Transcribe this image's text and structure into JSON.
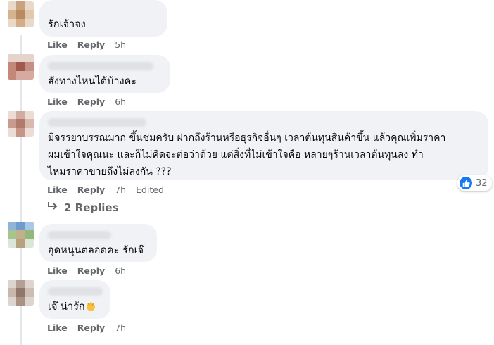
{
  "comments": [
    {
      "text": "รักเจ้าจง",
      "like": "Like",
      "reply": "Reply",
      "time": "5h"
    },
    {
      "text": "สังทางไหนได้บ้างคะ",
      "like": "Like",
      "reply": "Reply",
      "time": "6h"
    },
    {
      "text": "มีจรรยาบรรณมาก ขึ้นชมครับ ฝากถึงร้านหรือธุรกิจอื่นๆ เวลาต้นทุนสินค้าขึ้น แล้วคุณเพิ่มราคา\nผมเข้าใจคุณนะ และก็ไม่คิดจะต่อว่าด้วย แต่สิ่งที่ไม่เข้าใจคือ หลายๆร้านเวลาต้นทุนลง ทำ\nไหมราคาขายถึงไม่ลงกัน ???",
      "like": "Like",
      "reply": "Reply",
      "time": "7h",
      "edited": "Edited",
      "reaction_count": "32"
    },
    {
      "text": "อุดหนุนตลอดคะ รักเจ๊",
      "like": "Like",
      "reply": "Reply",
      "time": "6h"
    },
    {
      "text": "เจ๊ น่ารัก",
      "like": "Like",
      "reply": "Reply",
      "time": "7h"
    }
  ],
  "replies_label": "2 Replies",
  "colors": {
    "bubble": "#f0f2f5",
    "meta": "#65676b",
    "like_blue": "#1877f2"
  }
}
